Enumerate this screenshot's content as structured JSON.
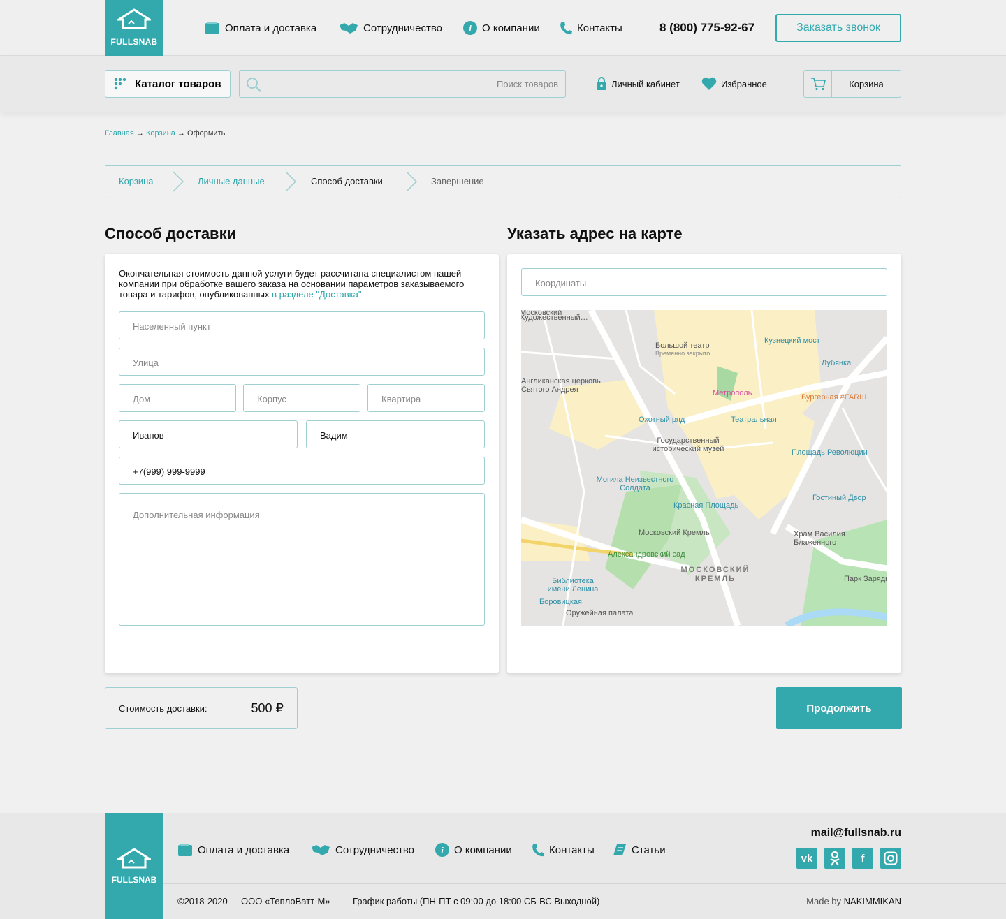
{
  "header": {
    "logo_text": "FULLSNAB",
    "nav": [
      "Оплата и доставка",
      "Сотрудничество",
      "О компании",
      "Контакты"
    ],
    "phone": "8 (800) 775-92-67",
    "callback_label": "Заказать звонок",
    "catalog_label": "Каталог товаров",
    "search_placeholder": "Поиск товаров",
    "account_label": "Личный кабинет",
    "favorites_label": "Избранное",
    "cart_label": "Корзина"
  },
  "breadcrumb": {
    "home": "Главная",
    "cart": "Корзина",
    "current": "Оформить",
    "sep": "→"
  },
  "steps": [
    "Корзина",
    "Личные данные",
    "Способ доставки",
    "Завершение"
  ],
  "delivery": {
    "title": "Способ доставки",
    "note": "Окончательная стоимость данной услуги будет рассчитана специалистом нашей компании при обработке вашего заказа на основании параметров заказываемого товара и тарифов, опубликованных",
    "note_link": "в разделе \"Доставка\"",
    "city_placeholder": "Населенный пункт",
    "street_placeholder": "Улица",
    "house_placeholder": "Дом",
    "building_placeholder": "Корпус",
    "flat_placeholder": "Квартира",
    "last_name": "Иванов",
    "first_name": "Вадим",
    "phone": "+7(999) 999-9999",
    "extra_placeholder": "Дополнительная информация"
  },
  "map_section": {
    "title": "Указать адрес на карте",
    "coords_placeholder": "Координаты",
    "labels": [
      "Большой театр",
      "Временно закрыто",
      "Кузнецкий мост",
      "Лубянка",
      "Метрополь",
      "Бургерная #FARШ",
      "Англиканская церковь Святого Андрея",
      "Охотный ряд",
      "Театральная",
      "Государственный исторический музей",
      "Площадь Революции",
      "Могила Неизвестного Солдата",
      "Гостиный Двор",
      "Красная Площадь",
      "Храм Василия Блаженного",
      "Московский Кремль",
      "Александровский сад",
      "МОСКОВСКИЙ КРЕМЛЬ",
      "Парк Зарядье",
      "Библиотека имени Ленина",
      "Боровицкая",
      "Оружейная палата"
    ]
  },
  "summary": {
    "cost_label": "Стоимость доставки:",
    "cost_value": "500 ₽",
    "continue_label": "Продолжить"
  },
  "footer": {
    "logo_text": "FULLSNAB",
    "nav": [
      "Оплата и доставка",
      "Сотрудничество",
      "О компании",
      "Контакты",
      "Статьи"
    ],
    "email": "mail@fullsnab.ru",
    "copyright": "©2018-2020",
    "company": "ООО «ТеплоВатт-М»",
    "hours": "График работы (ПН-ПТ с 09:00 до 18:00 СБ-ВС Выходной)",
    "made_by_prefix": "Made by",
    "made_by": "NAKIMMIKAN",
    "social": [
      "vk",
      "ok",
      "fb",
      "ig"
    ]
  },
  "colors": {
    "accent": "#33a9ae",
    "border": "#9fcfd1",
    "background": "#f0f0f0"
  }
}
